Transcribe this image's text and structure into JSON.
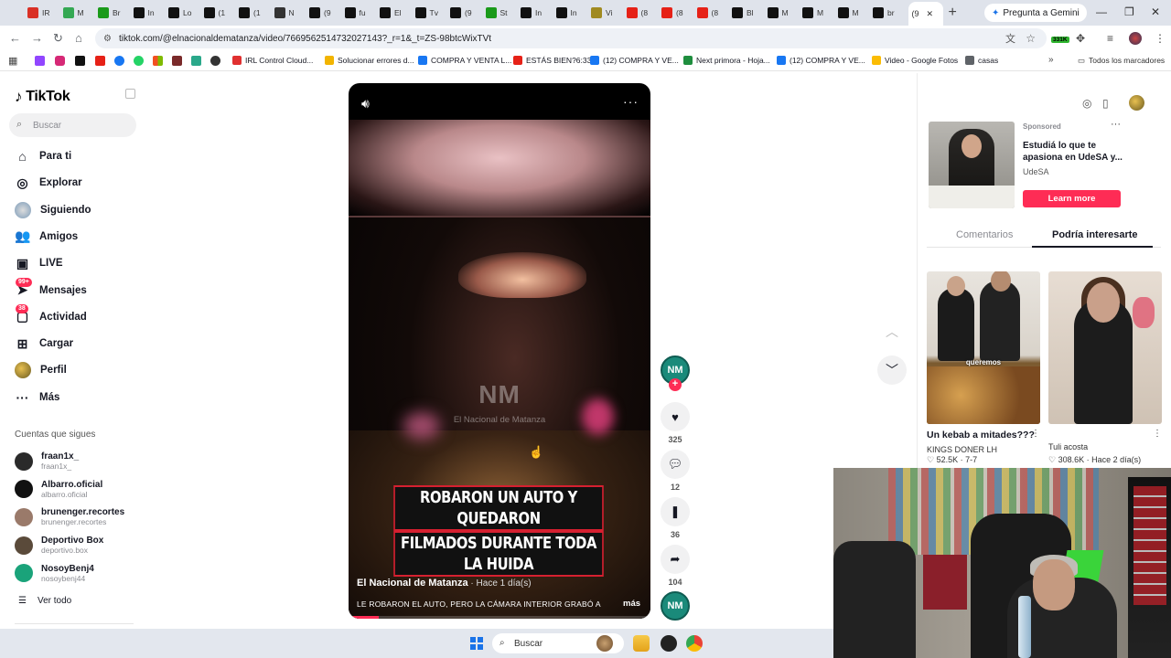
{
  "browser": {
    "tabs": [
      {
        "icon": "gmail-icon",
        "color": "#d93025",
        "label": "IR"
      },
      {
        "icon": "drive-icon",
        "color": "#34a853",
        "label": "M"
      },
      {
        "icon": "kick-icon",
        "color": "#1a9a1a",
        "label": "Br"
      },
      {
        "icon": "x-icon",
        "color": "#111111",
        "label": "In"
      },
      {
        "icon": "x-icon",
        "color": "#111111",
        "label": "Lo"
      },
      {
        "icon": "x-icon",
        "color": "#111111",
        "label": "(1"
      },
      {
        "icon": "x-icon",
        "color": "#111111",
        "label": "(1"
      },
      {
        "icon": "github-icon",
        "color": "#333333",
        "label": "N"
      },
      {
        "icon": "tiktok-icon",
        "color": "#111111",
        "label": "(9"
      },
      {
        "icon": "x-icon",
        "color": "#111111",
        "label": "fu"
      },
      {
        "icon": "x-icon",
        "color": "#111111",
        "label": "El"
      },
      {
        "icon": "x-icon",
        "color": "#111111",
        "label": "Tv"
      },
      {
        "icon": "tiktok-icon",
        "color": "#111111",
        "label": "(9"
      },
      {
        "icon": "kick-icon",
        "color": "#1a9a1a",
        "label": "St"
      },
      {
        "icon": "x-icon",
        "color": "#111111",
        "label": "In"
      },
      {
        "icon": "x-icon",
        "color": "#111111",
        "label": "In"
      },
      {
        "icon": "vimeo-icon",
        "color": "#a08a20",
        "label": "Vi"
      },
      {
        "icon": "youtube-icon",
        "color": "#e62117",
        "label": "(8"
      },
      {
        "icon": "youtube-icon",
        "color": "#e62117",
        "label": "(8"
      },
      {
        "icon": "youtube-icon",
        "color": "#e62117",
        "label": "(8"
      },
      {
        "icon": "x-icon",
        "color": "#111111",
        "label": "Bl"
      },
      {
        "icon": "x-icon",
        "color": "#111111",
        "label": "M"
      },
      {
        "icon": "x-icon",
        "color": "#111111",
        "label": "M"
      },
      {
        "icon": "x-icon",
        "color": "#111111",
        "label": "M"
      },
      {
        "icon": "x-icon",
        "color": "#111111",
        "label": "br"
      }
    ],
    "active_tab": {
      "label": "(9",
      "close": "✕"
    },
    "new_tab": "+",
    "gemini_label": "Pregunta a Gemini",
    "window_min": "—",
    "window_max": "❐",
    "window_close": "✕",
    "url": "tiktok.com/@elnacionaldematanza/video/7669562514732027143?_r=1&_t=ZS-98btcWixTVt",
    "extension_badge": "331K",
    "bookmarks": [
      {
        "label": "IRL Control Cloud...",
        "color": "#e03030"
      },
      {
        "label": "Solucionar errores d...",
        "color": "#f2b400"
      },
      {
        "label": "COMPRA Y VENTA L...",
        "color": "#1877f2"
      },
      {
        "label": "ESTÁS BIEN?6:33",
        "color": "#e62117"
      },
      {
        "label": "(12) COMPRA Y VE...",
        "color": "#1877f2"
      },
      {
        "label": "Next primora - Hoja...",
        "color": "#1e8e3e"
      },
      {
        "label": "(12) COMPRA Y VE...",
        "color": "#1877f2"
      },
      {
        "label": "Video - Google Fotos",
        "color": "#fbbc04"
      },
      {
        "label": "casas",
        "color": "#5f6368"
      }
    ],
    "bookmarks_more": "»",
    "all_bookmarks": "Todos los marcadores"
  },
  "sidebar": {
    "logo": "TikTok",
    "search_placeholder": "Buscar",
    "items": [
      {
        "label": "Para ti",
        "icon": "home-icon",
        "glyph": "⌂"
      },
      {
        "label": "Explorar",
        "icon": "compass-icon",
        "glyph": "◎"
      },
      {
        "label": "Siguiendo",
        "icon": "following-avatar-icon",
        "glyph": "●"
      },
      {
        "label": "Amigos",
        "icon": "friends-icon",
        "glyph": "👥"
      },
      {
        "label": "LIVE",
        "icon": "live-icon",
        "glyph": "▣"
      },
      {
        "label": "Mensajes",
        "icon": "messages-icon",
        "glyph": "➤",
        "badge": "99+"
      },
      {
        "label": "Actividad",
        "icon": "activity-icon",
        "glyph": "▢",
        "badge": "38"
      },
      {
        "label": "Cargar",
        "icon": "upload-icon",
        "glyph": "⊞"
      },
      {
        "label": "Perfil",
        "icon": "profile-avatar-icon",
        "glyph": "●"
      },
      {
        "label": "Más",
        "icon": "more-icon",
        "glyph": "···"
      }
    ],
    "following_title": "Cuentas que sigues",
    "following": [
      {
        "name": "fraan1x_",
        "handle": "fraan1x_",
        "color": "#2a2a2a"
      },
      {
        "name": "Albarro.oficial",
        "handle": "albarro.oficial",
        "color": "#111111"
      },
      {
        "name": "brunenger.recortes",
        "handle": "brunenger.recortes",
        "color": "#9a7a6a"
      },
      {
        "name": "Deportivo Box",
        "handle": "deportivo.box",
        "color": "#5a4a3a"
      },
      {
        "name": "NosoyBenj4",
        "handle": "nosoybenj44",
        "color": "#1aa37a"
      }
    ],
    "see_all": "Ver todo"
  },
  "video": {
    "watermark_big": "NM",
    "watermark_small": "El Nacional de Matanza",
    "caption_line1": "ROBARON UN AUTO Y QUEDARON",
    "caption_line2": "FILMADOS DURANTE TODA LA HUIDA",
    "author": "El Nacional de Matanza",
    "time": " · Hace 1 día(s)",
    "description": "LE ROBARON EL AUTO, PERO LA CÁMARA INTERIOR GRABÓ A",
    "more": "más",
    "progress_fraction": 0.1
  },
  "actions": {
    "avatar_label": "NM",
    "follow_plus": "+",
    "likes": "325",
    "comments": "12",
    "saves": "36",
    "shares": "104",
    "sound_avatar_label": "NM"
  },
  "right_panel": {
    "ad": {
      "sponsored": "Sponsored",
      "more": "···",
      "title": "Estudiá lo que te apasiona en UdeSA y...",
      "brand": "UdeSA",
      "cta": "Learn more"
    },
    "tabs": {
      "comments": "Comentarios",
      "suggested": "Podría interesarte"
    },
    "suggestions": [
      {
        "title": "Un kebab a mitades???",
        "author": "KINGS DONER LH",
        "likes": "52.5K",
        "date": "7-7",
        "overlay": "queremos"
      },
      {
        "title": "",
        "author": "Tuli acosta",
        "likes": "308.6K",
        "date": "Hace 2 día(s)"
      }
    ]
  },
  "taskbar": {
    "search_placeholder": "Buscar"
  }
}
